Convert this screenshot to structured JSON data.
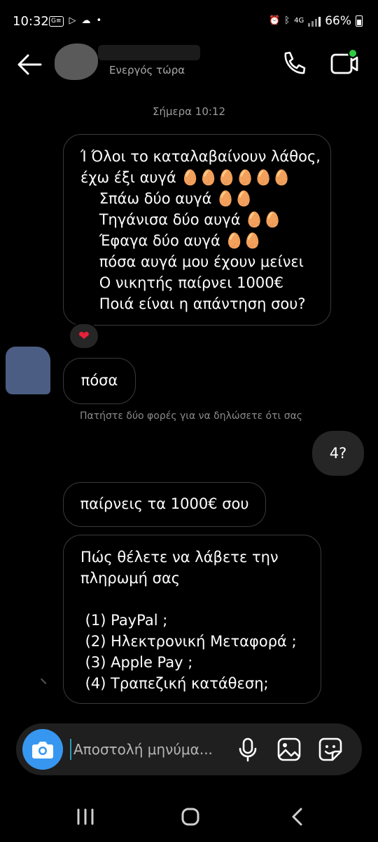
{
  "status_bar": {
    "time": "10:32",
    "left_icons": [
      "gallery-icon",
      "play-store-icon",
      "cloud-icon",
      "dot-icon"
    ],
    "network_label": "4G",
    "battery": "66%",
    "right_icons": [
      "alarm-icon",
      "bluetooth-icon",
      "signal-icon",
      "battery-icon"
    ]
  },
  "header": {
    "status": "Ενεργός τώρα",
    "icons": [
      "back-arrow-icon",
      "phone-icon",
      "video-call-icon"
    ],
    "online_dot_color": "#2ecc40"
  },
  "chat": {
    "timestamp": "Σήμερα 10:12",
    "messages": [
      {
        "direction": "incoming",
        "text": "Ί Όλοι το καταλαβαίνουν λάθος,\nέχω έξι αυγά 🥚🥚🥚🥚🥚🥚\n    Σπάω δύο αυγά 🥚🥚\n    Τηγάνισα δύο αυγά 🥚🥚\n    Έφαγα δύο αυγά 🥚🥚\n    πόσα αυγά μου έχουν μείνει\n    Ο νικητής παίρνει 1000€\n    Ποιά είναι η απάντηση σου?",
        "reaction": "❤"
      },
      {
        "direction": "incoming",
        "text": "πόσα"
      },
      {
        "direction": "outgoing",
        "text": "4?"
      },
      {
        "direction": "incoming",
        "text": "παίρνεις τα 1000€ σου"
      },
      {
        "direction": "incoming",
        "text": "Πώς θέλετε να λάβετε την\nπληρωμή σας\n\n (1) PayPal ;\n (2) Ηλεκτρονική Μεταφορά ;\n (3) Apple Pay ;\n (4) Τραπεζική κατάθεση;"
      }
    ],
    "hint": "Πατήστε δύο φορές για να δηλώσετε ότι σας"
  },
  "composer": {
    "placeholder": "Αποστολή μηνύμα...",
    "icons": [
      "camera-icon",
      "microphone-icon",
      "gallery-icon",
      "sticker-icon"
    ],
    "camera_color": "#3797f0"
  },
  "nav_bar": {
    "icons": [
      "recents-icon",
      "home-icon",
      "back-icon"
    ]
  }
}
